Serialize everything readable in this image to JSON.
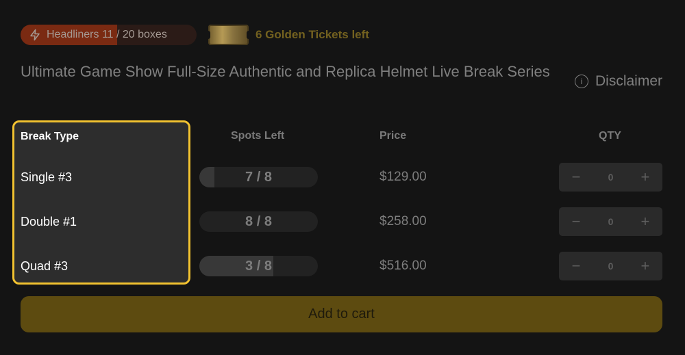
{
  "headliners": {
    "label": "Headliners",
    "count": "11",
    "total_label": "/ 20 boxes",
    "fill_fraction": 0.55
  },
  "golden": {
    "text": "6 Golden Tickets left"
  },
  "title": "Ultimate Game Show Full-Size Authentic and Replica Helmet Live Break Series",
  "disclaimer": {
    "label": "Disclaimer",
    "icon": "info-icon"
  },
  "columns": {
    "break_type": "Break Type",
    "spots_left": "Spots Left",
    "price": "Price",
    "qty": "QTY"
  },
  "rows": [
    {
      "name": "Single #3",
      "spots": "7 / 8",
      "spots_filled_fraction": 0.125,
      "price": "$129.00",
      "qty": "0"
    },
    {
      "name": "Double #1",
      "spots": "8 / 8",
      "spots_filled_fraction": 0.0,
      "price": "$258.00",
      "qty": "0"
    },
    {
      "name": "Quad #3",
      "spots": "3 / 8",
      "spots_filled_fraction": 0.625,
      "price": "$516.00",
      "qty": "0"
    }
  ],
  "qty_controls": {
    "minus": "−",
    "plus": "+"
  },
  "add_to_cart": "Add to cart",
  "colors": {
    "accent_yellow": "#f2c230",
    "headliner_red": "#7a2a12",
    "button_gold": "#5d4b10"
  }
}
